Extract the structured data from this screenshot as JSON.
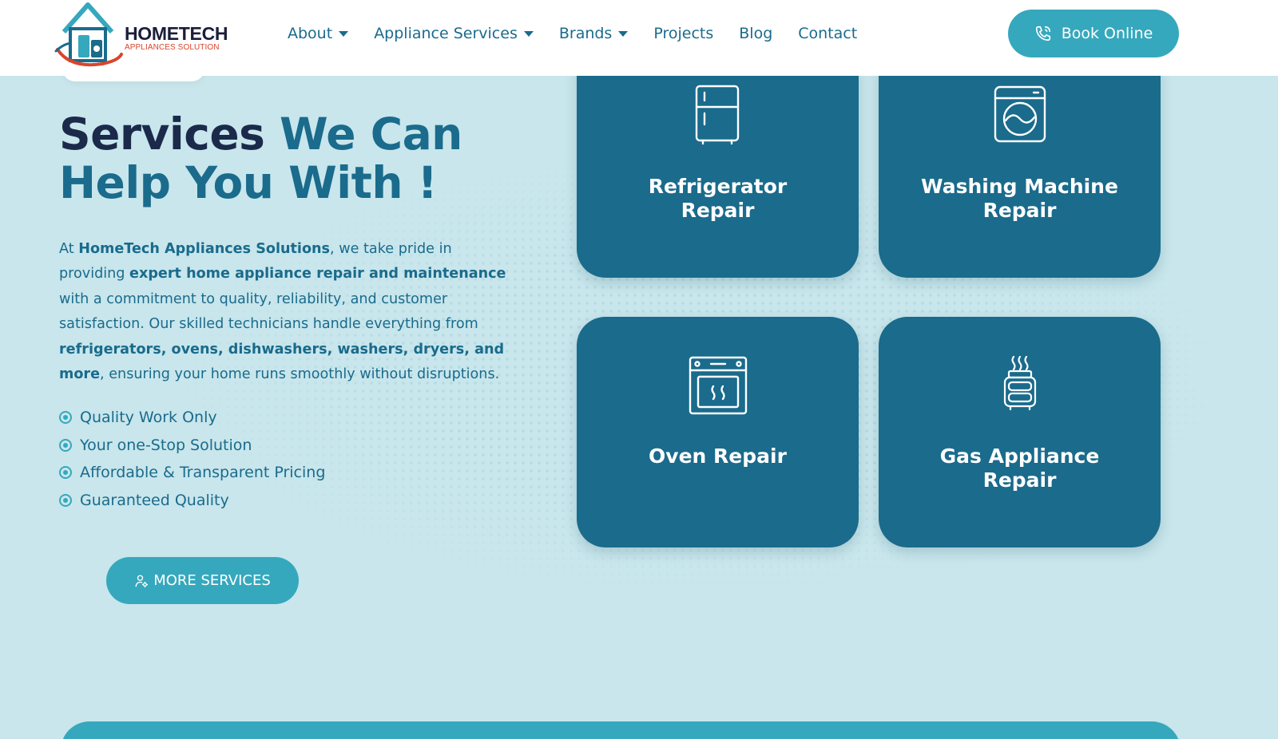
{
  "brand": {
    "name": "HOMETECH",
    "tagline": "APPLIANCES SOLUTION",
    "colors": {
      "primary": "#1a6b8c",
      "accent": "#36a8bd",
      "dark": "#1b2a4a",
      "logo_orange": "#d9452b"
    }
  },
  "nav": {
    "items": [
      {
        "label": "About",
        "dropdown": true
      },
      {
        "label": "Appliance Services",
        "dropdown": true
      },
      {
        "label": "Brands",
        "dropdown": true
      },
      {
        "label": "Projects",
        "dropdown": false
      },
      {
        "label": "Blog",
        "dropdown": false
      },
      {
        "label": "Contact",
        "dropdown": false
      }
    ],
    "cta_label": "Book Online",
    "cta_icon": "phone-icon"
  },
  "hero": {
    "heading_dark": "Services ",
    "heading_teal_1": "We Can",
    "heading_teal_2": "Help You With !",
    "paragraph": {
      "p1": "At ",
      "b1": "HomeTech Appliances Solutions",
      "p2": ", we take pride in providing ",
      "b2": "expert home appliance repair and maintenance",
      "p3": " with a commitment to quality, reliability, and customer satisfaction. Our skilled technicians handle everything from ",
      "b3": "refrigerators, ovens, dishwashers, washers, dryers, and more",
      "p4": ", ensuring your home runs smoothly without disruptions."
    },
    "checklist": [
      "Quality Work Only",
      "Your one-Stop Solution",
      "Affordable & Transparent Pricing",
      "Guaranteed Quality"
    ],
    "more_button_label": "MORE SERVICES",
    "more_button_icon": "user-gear-icon"
  },
  "services": [
    {
      "title": "Refrigerator Repair",
      "icon": "refrigerator-icon"
    },
    {
      "title": "Washing Machine Repair",
      "icon": "washing-machine-icon"
    },
    {
      "title": "Oven Repair",
      "icon": "oven-icon"
    },
    {
      "title": "Gas Appliance Repair",
      "icon": "gas-appliance-icon"
    }
  ]
}
